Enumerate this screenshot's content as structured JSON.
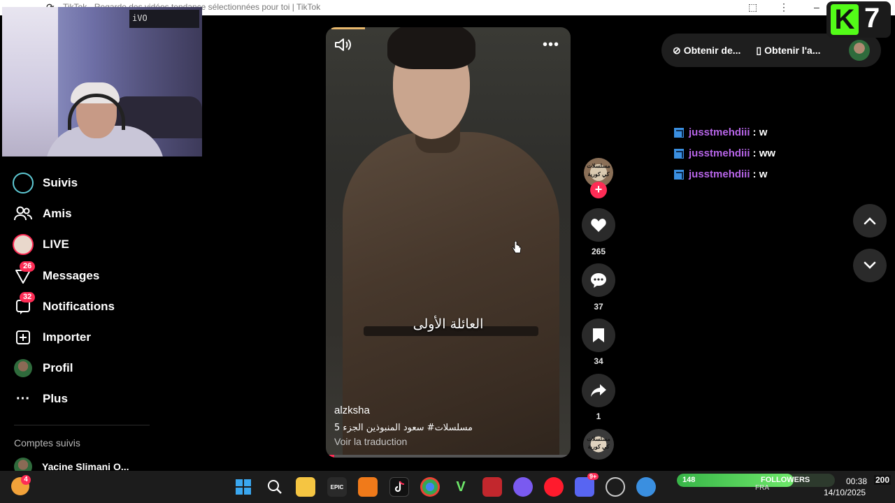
{
  "browser": {
    "title": "TikTok - Regarde des vidéos tendance sélectionnées pour toi | TikTok"
  },
  "webcam": {
    "tag": "iVO"
  },
  "sidebar": {
    "items": [
      {
        "label": "Suivis"
      },
      {
        "label": "Amis"
      },
      {
        "label": "LIVE"
      },
      {
        "label": "Messages",
        "badge": "26"
      },
      {
        "label": "Notifications",
        "badge": "32"
      },
      {
        "label": "Importer"
      },
      {
        "label": "Profil"
      },
      {
        "label": "Plus"
      }
    ],
    "followed_title": "Comptes suivis",
    "followed": [
      {
        "label": "Yacine Slimani O..."
      }
    ]
  },
  "video": {
    "subtitle": "العائلة الأولى",
    "author": "alzksha",
    "caption": "5 مسلسلات# سعود المنبوذين الجزء",
    "translate": "Voir la traduction",
    "creator_avatar_text": "مسلسلات كي كورية",
    "music_text": "مسلسلات كي كورية"
  },
  "actions": {
    "likes": "265",
    "comments": "37",
    "saves": "34",
    "shares": "1"
  },
  "top_actions": {
    "get_coins": "Obtenir de...",
    "get_app": "Obtenir l'a..."
  },
  "overlay": {
    "k": "K",
    "num": "7"
  },
  "chat": [
    {
      "user": "jusstmehdiii",
      "message": ": w"
    },
    {
      "user": "jusstmehdiii",
      "message": ": ww"
    },
    {
      "user": "jusstmehdiii",
      "message": ": w"
    }
  ],
  "taskbar": {
    "weather_badge": "4",
    "epic_label": "EPIC",
    "discord_badge": "9+",
    "followers_count": "148",
    "followers_label": "FOLLOWERS",
    "followers_goal": "200",
    "followers_progress": 0.74,
    "timer": "00:38",
    "lang": "FRA",
    "date": "14/10/2025"
  },
  "colors": {
    "accent": "#fe2c55",
    "chat_user": "#b765e8",
    "kick_green": "#53fc18"
  }
}
